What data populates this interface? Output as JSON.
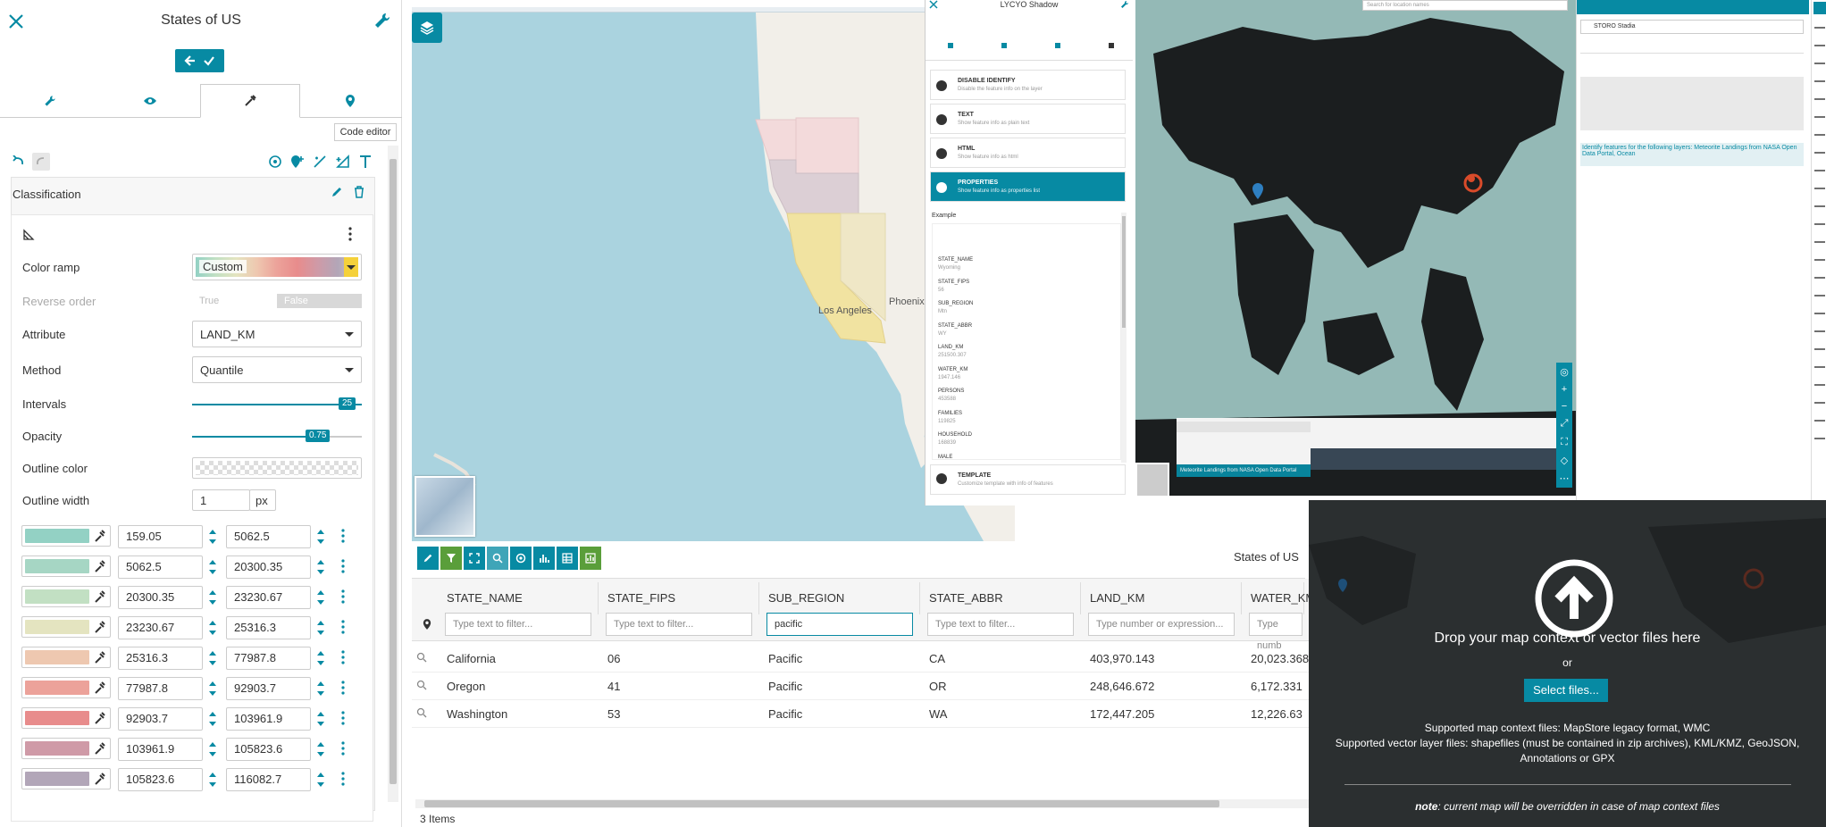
{
  "style_editor": {
    "title": "States of US",
    "code_editor_label": "Code editor",
    "rule_title": "Classification",
    "fields": {
      "color_ramp_label": "Color ramp",
      "color_ramp_value": "Custom",
      "reverse_label": "Reverse order",
      "reverse_true": "True",
      "reverse_false": "False",
      "attribute_label": "Attribute",
      "attribute_value": "LAND_KM",
      "method_label": "Method",
      "method_value": "Quantile",
      "intervals_label": "Intervals",
      "intervals_value": "25",
      "intervals_fraction": 1.0,
      "opacity_label": "Opacity",
      "opacity_value": "0.75",
      "opacity_fraction": 0.75,
      "outline_color_label": "Outline color",
      "outline_width_label": "Outline width",
      "outline_width_value": "1",
      "outline_width_unit": "px"
    },
    "classes": [
      {
        "color": "#93d1c4",
        "min": "159.05",
        "max": "5062.5"
      },
      {
        "color": "#a6d6c4",
        "min": "5062.5",
        "max": "20300.35"
      },
      {
        "color": "#c2e0c3",
        "min": "20300.35",
        "max": "23230.67"
      },
      {
        "color": "#e4e4c0",
        "min": "23230.67",
        "max": "25316.3"
      },
      {
        "color": "#eec8b0",
        "min": "25316.3",
        "max": "77987.8"
      },
      {
        "color": "#eca29a",
        "min": "77987.8",
        "max": "92903.7"
      },
      {
        "color": "#e88c8c",
        "min": "92903.7",
        "max": "103961.9"
      },
      {
        "color": "#cf9aa7",
        "min": "103961.9",
        "max": "105823.6"
      },
      {
        "color": "#b2a6b8",
        "min": "105823.6",
        "max": "116082.7"
      }
    ]
  },
  "map": {
    "labels": {
      "los_angeles": "Los Angeles",
      "phoenix": "Phoenix"
    }
  },
  "attribute_table": {
    "layer_title": "States of US",
    "columns": [
      "STATE_NAME",
      "STATE_FIPS",
      "SUB_REGION",
      "STATE_ABBR",
      "LAND_KM",
      "WATER_KM"
    ],
    "filters": {
      "placeholder_text": "Type text to filter...",
      "placeholder_number": "Type number or expression...",
      "placeholder_number_cut": "Type numb",
      "sub_region_value": "pacific"
    },
    "rows": [
      {
        "name": "California",
        "fips": "06",
        "region": "Pacific",
        "abbr": "CA",
        "land": "403,970.143",
        "water": "20,023.368"
      },
      {
        "name": "Oregon",
        "fips": "41",
        "region": "Pacific",
        "abbr": "OR",
        "land": "248,646.672",
        "water": "6,172.331"
      },
      {
        "name": "Washington",
        "fips": "53",
        "region": "Pacific",
        "abbr": "WA",
        "land": "172,447.205",
        "water": "12,226.63"
      }
    ],
    "footer": "3 Items"
  },
  "identify": {
    "title": "LYCYO Shadow",
    "items": [
      {
        "title": "DISABLE IDENTIFY",
        "sub": "Disable the feature info on the layer"
      },
      {
        "title": "TEXT",
        "sub": "Show feature info as plain text"
      },
      {
        "title": "HTML",
        "sub": "Show feature info as html"
      },
      {
        "title": "PROPERTIES",
        "sub": "Show feature info as properties list"
      }
    ],
    "example_label": "Example",
    "props": [
      {
        "k": "STATE_NAME",
        "v": "Wyoming"
      },
      {
        "k": "STATE_FIPS",
        "v": "56"
      },
      {
        "k": "SUB_REGION",
        "v": "Mtn"
      },
      {
        "k": "STATE_ABBR",
        "v": "WY"
      },
      {
        "k": "LAND_KM",
        "v": "251500.307"
      },
      {
        "k": "WATER_KM",
        "v": "1947.146"
      },
      {
        "k": "PERSONS",
        "v": "453588"
      },
      {
        "k": "FAMILIES",
        "v": "119825"
      },
      {
        "k": "HOUSEHOLD",
        "v": "168839"
      },
      {
        "k": "MALE",
        "v": ""
      }
    ],
    "template_title": "TEMPLATE",
    "template_sub": "Customize template with info of features"
  },
  "right_panel": {
    "search_placeholder": "Search for location names",
    "layer_select": "STORO Stadia",
    "info_text": "Identify features for the following layers: Meteorite Landings from NASA Open Data Portal, Ocean",
    "timeline_label": "Meteorite Landings from NASA Open Data Portal"
  },
  "import_panel": {
    "drop_title": "Drop your map context or vector files here",
    "or_label": "or",
    "select_button": "Select files...",
    "supported_context": "Supported map context files: MapStore legacy format, WMC",
    "supported_vector_1": "Supported vector layer files: shapefiles (must be contained in zip archives), KML/KMZ, GeoJSON,",
    "supported_vector_2": "Annotations or GPX",
    "note_bold": "note",
    "note_text": ": current map will be overridden in case of map context files"
  },
  "colors": {
    "accent": "#078aa3",
    "dark_bg": "#2b2f30"
  }
}
